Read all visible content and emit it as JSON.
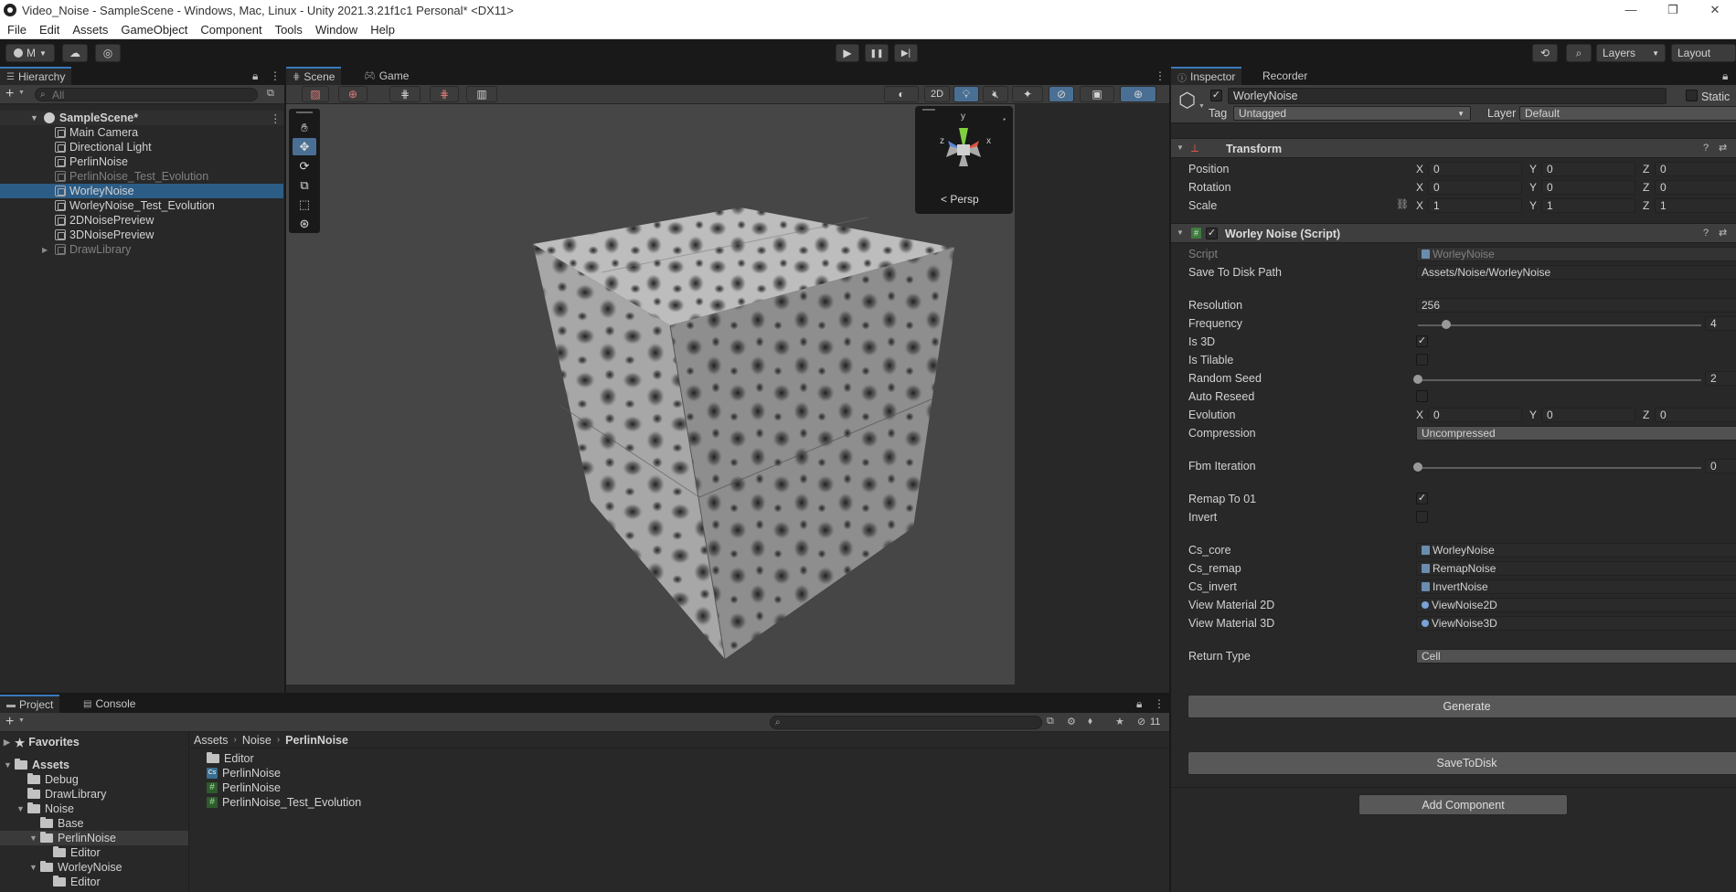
{
  "window": {
    "title": "Video_Noise - SampleScene - Windows, Mac, Linux - Unity 2021.3.21f1c1 Personal* <DX11>",
    "controls": [
      "—",
      "❐",
      "✕"
    ]
  },
  "menu": [
    "File",
    "Edit",
    "Assets",
    "GameObject",
    "Component",
    "Tools",
    "Window",
    "Help"
  ],
  "toolbar": {
    "account_label": "M",
    "play": "▶",
    "pause": "❚❚",
    "step": "▶|",
    "layers_label": "Layers",
    "layout_label": "Layout"
  },
  "hierarchy": {
    "tab": "Hierarchy",
    "search_placeholder": "All",
    "scene": "SampleScene*",
    "items": [
      {
        "label": "Main Camera",
        "state": "normal"
      },
      {
        "label": "Directional Light",
        "state": "normal"
      },
      {
        "label": "PerlinNoise",
        "state": "normal"
      },
      {
        "label": "PerlinNoise_Test_Evolution",
        "state": "dim"
      },
      {
        "label": "WorleyNoise",
        "state": "selected"
      },
      {
        "label": "WorleyNoise_Test_Evolution",
        "state": "normal"
      },
      {
        "label": "2DNoisePreview",
        "state": "normal"
      },
      {
        "label": "3DNoisePreview",
        "state": "normal"
      },
      {
        "label": "DrawLibrary",
        "state": "dim"
      }
    ]
  },
  "scene": {
    "tabs": [
      "Scene",
      "Game"
    ],
    "toggle_2d": "2D",
    "gizmo": {
      "y": "y",
      "x": "x",
      "z": "z",
      "persp": "< Persp"
    }
  },
  "inspector": {
    "tabs": [
      "Inspector",
      "Recorder"
    ],
    "object_name": "WorleyNoise",
    "static_label": "Static",
    "tag_label": "Tag",
    "tag_value": "Untagged",
    "layer_label": "Layer",
    "layer_value": "Default",
    "transform": {
      "title": "Transform",
      "position": {
        "label": "Position",
        "x": "0",
        "y": "0",
        "z": "0"
      },
      "rotation": {
        "label": "Rotation",
        "x": "0",
        "y": "0",
        "z": "0"
      },
      "scale": {
        "label": "Scale",
        "x": "1",
        "y": "1",
        "z": "1"
      }
    },
    "script": {
      "title": "Worley Noise (Script)",
      "script_label": "Script",
      "script_value": "WorleyNoise",
      "save_path_label": "Save To Disk Path",
      "save_path_value": "Assets/Noise/WorleyNoise",
      "resolution_label": "Resolution",
      "resolution_value": "256",
      "frequency_label": "Frequency",
      "frequency_value": "4",
      "frequency_fraction": 0.1,
      "is3d_label": "Is 3D",
      "is3d": true,
      "is_tilable_label": "Is Tilable",
      "is_tilable": false,
      "random_seed_label": "Random Seed",
      "random_seed_value": "2",
      "random_seed_fraction": 0.0,
      "auto_reseed_label": "Auto Reseed",
      "auto_reseed": false,
      "evolution": {
        "label": "Evolution",
        "x": "0",
        "y": "0",
        "z": "0"
      },
      "compression_label": "Compression",
      "compression_value": "Uncompressed",
      "fbm_label": "Fbm Iteration",
      "fbm_value": "0",
      "fbm_fraction": 0.0,
      "remap_label": "Remap To 01",
      "remap": true,
      "invert_label": "Invert",
      "invert": false,
      "cs_core_label": "Cs_core",
      "cs_core_value": "WorleyNoise",
      "cs_remap_label": "Cs_remap",
      "cs_remap_value": "RemapNoise",
      "cs_invert_label": "Cs_invert",
      "cs_invert_value": "InvertNoise",
      "view2d_label": "View Material 2D",
      "view2d_value": "ViewNoise2D",
      "view3d_label": "View Material 3D",
      "view3d_value": "ViewNoise3D",
      "return_type_label": "Return Type",
      "return_type_value": "Cell",
      "generate_button": "Generate",
      "save_button": "SaveToDisk"
    },
    "add_component": "Add Component"
  },
  "project": {
    "tabs": [
      "Project",
      "Console"
    ],
    "hidden_count": "11",
    "favorites": "Favorites",
    "breadcrumb": [
      "Assets",
      "Noise",
      "PerlinNoise"
    ],
    "tree": [
      {
        "label": "Assets",
        "indent": 0,
        "arrow": "▼",
        "bold": true
      },
      {
        "label": "Debug",
        "indent": 1,
        "arrow": ""
      },
      {
        "label": "DrawLibrary",
        "indent": 1,
        "arrow": ""
      },
      {
        "label": "Noise",
        "indent": 1,
        "arrow": "▼"
      },
      {
        "label": "Base",
        "indent": 2,
        "arrow": ""
      },
      {
        "label": "PerlinNoise",
        "indent": 2,
        "arrow": "▼",
        "selected": true
      },
      {
        "label": "Editor",
        "indent": 3,
        "arrow": ""
      },
      {
        "label": "WorleyNoise",
        "indent": 2,
        "arrow": "▼"
      },
      {
        "label": "Editor",
        "indent": 3,
        "arrow": ""
      }
    ],
    "files": [
      {
        "label": "Editor",
        "icon": "folder"
      },
      {
        "label": "PerlinNoise",
        "icon": "cs"
      },
      {
        "label": "PerlinNoise",
        "icon": "hash"
      },
      {
        "label": "PerlinNoise_Test_Evolution",
        "icon": "hash"
      }
    ]
  },
  "colors": {
    "selection": "#2c5d87",
    "accent": "#3a79bb"
  }
}
